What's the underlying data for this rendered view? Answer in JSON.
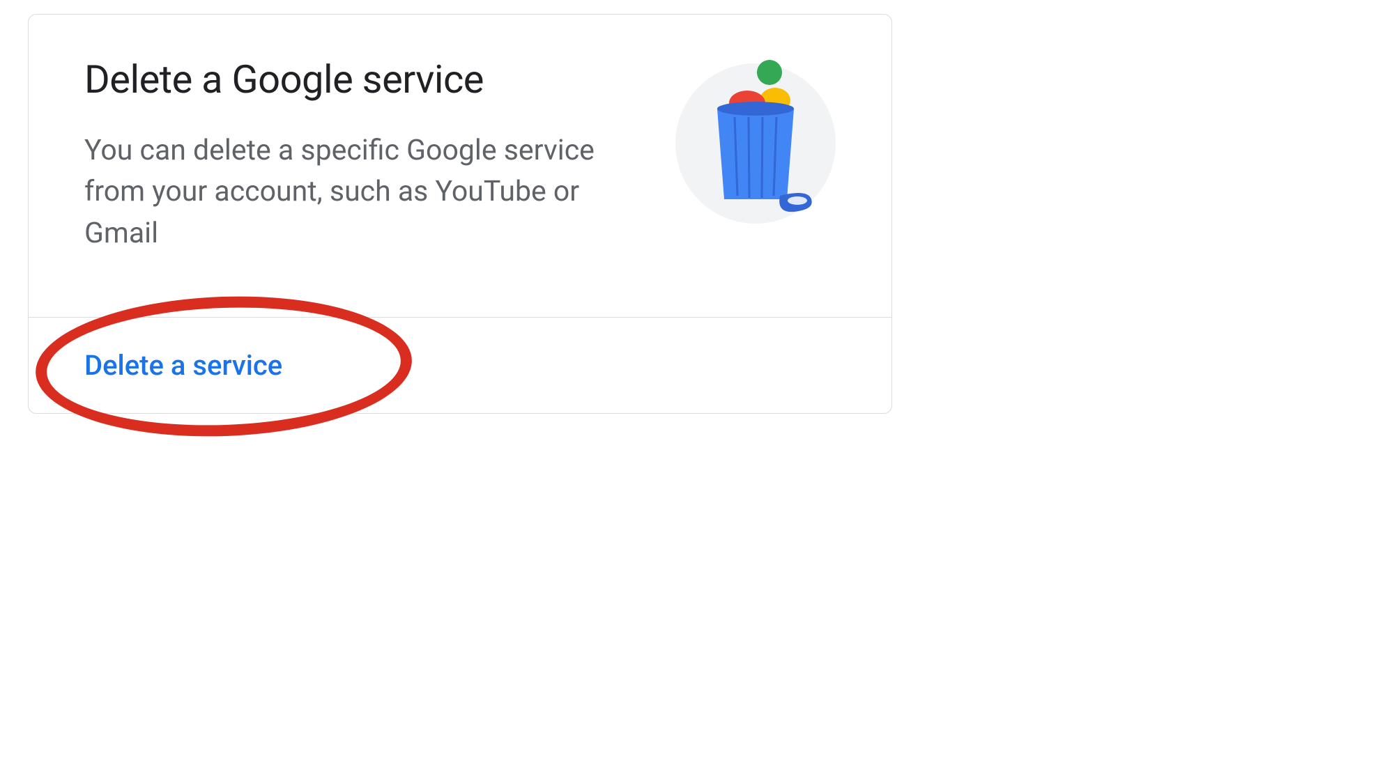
{
  "card": {
    "title": "Delete a Google service",
    "description": "You can delete a specific Google ser­vice from your account, such as You­Tube or Gmail",
    "action_label": "Delete a service"
  }
}
